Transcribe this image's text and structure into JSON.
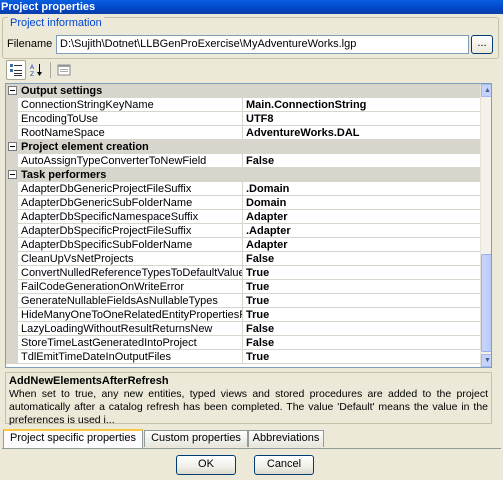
{
  "window": {
    "title": "Project properties"
  },
  "project_info": {
    "legend": "Project information",
    "filename_label": "Filename",
    "filename_value": "D:\\Sujith\\Dotnet\\LLBGenProExercise\\MyAdventureWorks.lgp",
    "browse_label": "..."
  },
  "property_grid": {
    "categories": [
      {
        "label": "Output settings",
        "rows": [
          {
            "name": "ConnectionStringKeyName",
            "value": "Main.ConnectionString"
          },
          {
            "name": "EncodingToUse",
            "value": "UTF8"
          },
          {
            "name": "RootNameSpace",
            "value": "AdventureWorks.DAL"
          }
        ]
      },
      {
        "label": "Project element creation",
        "rows": [
          {
            "name": "AutoAssignTypeConverterToNewField",
            "value": "False"
          }
        ]
      },
      {
        "label": "Task performers",
        "rows": [
          {
            "name": "AdapterDbGenericProjectFileSuffix",
            "value": ".Domain"
          },
          {
            "name": "AdapterDbGenericSubFolderName",
            "value": "Domain"
          },
          {
            "name": "AdapterDbSpecificNamespaceSuffix",
            "value": "Adapter"
          },
          {
            "name": "AdapterDbSpecificProjectFileSuffix",
            "value": ".Adapter"
          },
          {
            "name": "AdapterDbSpecificSubFolderName",
            "value": "Adapter"
          },
          {
            "name": "CleanUpVsNetProjects",
            "value": "False"
          },
          {
            "name": "ConvertNulledReferenceTypesToDefaultValue",
            "value": "True"
          },
          {
            "name": "FailCodeGenerationOnWriteError",
            "value": "True"
          },
          {
            "name": "GenerateNullableFieldsAsNullableTypes",
            "value": "True"
          },
          {
            "name": "HideManyOneToOneRelatedEntityPropertiesFromD",
            "value": "True"
          },
          {
            "name": "LazyLoadingWithoutResultReturnsNew",
            "value": "False"
          },
          {
            "name": "StoreTimeLastGeneratedIntoProject",
            "value": "False"
          },
          {
            "name": "TdlEmitTimeDateInOutputFiles",
            "value": "True"
          }
        ]
      }
    ]
  },
  "description": {
    "title": "AddNewElementsAfterRefresh",
    "text": "When set to true, any new entities, typed views and stored procedures are added to the project automatically after a catalog refresh has been completed. The value 'Default' means the value in the preferences is used i..."
  },
  "tabs": [
    {
      "label": "Project specific properties",
      "active": true
    },
    {
      "label": "Custom properties",
      "active": false
    },
    {
      "label": "Abbreviations",
      "active": false
    }
  ],
  "buttons": {
    "ok": "OK",
    "cancel": "Cancel"
  },
  "colors": {
    "title_bar": "#0046c8",
    "group_legend": "#0046d5",
    "category_bg": "#d8d5cc"
  }
}
